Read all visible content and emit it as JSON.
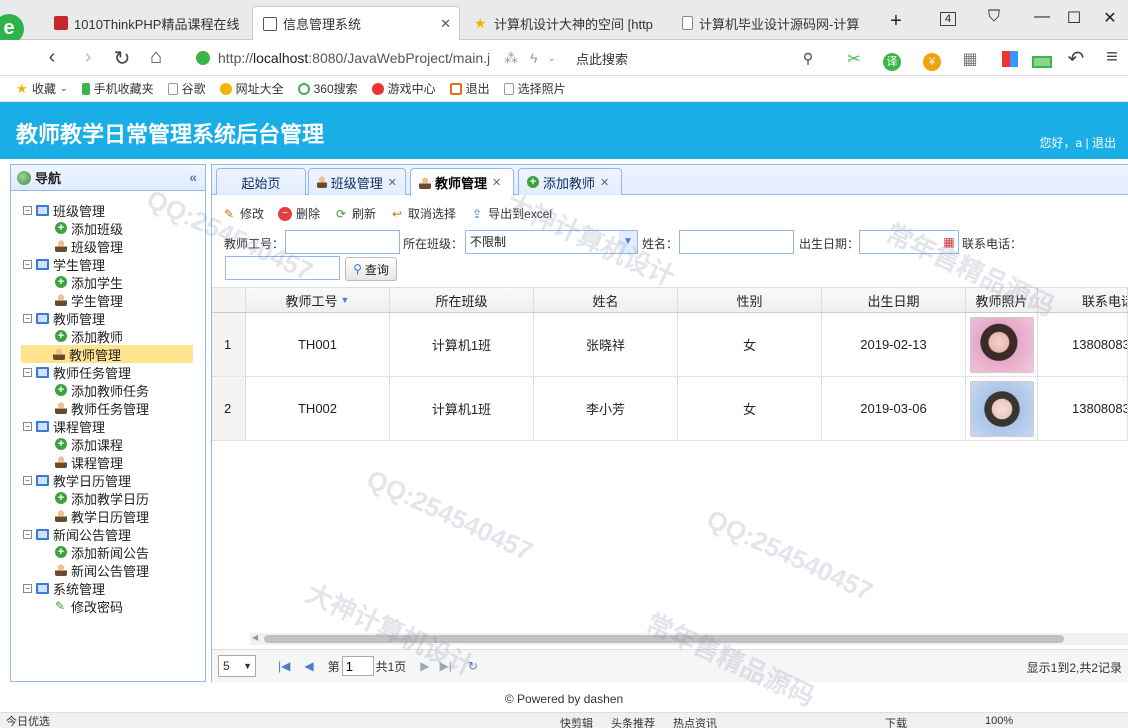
{
  "browser": {
    "tabs": [
      {
        "title": "1010ThinkPHP精品课程在线",
        "active": false
      },
      {
        "title": "信息管理系统",
        "active": true
      },
      {
        "title": "计算机设计大神的空间 [http",
        "active": false
      },
      {
        "title": "计算机毕业设计源码网-计算",
        "active": false
      }
    ],
    "new_tab": "+",
    "tab_count": "4",
    "url_prefix": "http://",
    "url_host": "localhost",
    "url_rest": ":8080/JavaWebProject/main.j",
    "search_placeholder": "点此搜索",
    "bookmarks": [
      "收藏",
      "手机收藏夹",
      "谷歌",
      "网址大全",
      "360搜索",
      "游戏中心",
      "退出",
      "选择照片"
    ]
  },
  "app": {
    "title": "教师教学日常管理系统后台管理",
    "greeting": "您好，a | 退出"
  },
  "nav": {
    "title": "导航",
    "collapse": "«",
    "groups": [
      {
        "label": "班级管理",
        "items": [
          {
            "label": "添加班级",
            "icon": "add"
          },
          {
            "label": "班级管理",
            "icon": "user"
          }
        ]
      },
      {
        "label": "学生管理",
        "items": [
          {
            "label": "添加学生",
            "icon": "add"
          },
          {
            "label": "学生管理",
            "icon": "user"
          }
        ]
      },
      {
        "label": "教师管理",
        "items": [
          {
            "label": "添加教师",
            "icon": "add"
          },
          {
            "label": "教师管理",
            "icon": "user"
          }
        ]
      },
      {
        "label": "教师任务管理",
        "items": [
          {
            "label": "添加教师任务",
            "icon": "add"
          },
          {
            "label": "教师任务管理",
            "icon": "user"
          }
        ]
      },
      {
        "label": "课程管理",
        "items": [
          {
            "label": "添加课程",
            "icon": "add"
          },
          {
            "label": "课程管理",
            "icon": "user"
          }
        ]
      },
      {
        "label": "教学日历管理",
        "items": [
          {
            "label": "添加教学日历",
            "icon": "add"
          },
          {
            "label": "教学日历管理",
            "icon": "user"
          }
        ]
      },
      {
        "label": "新闻公告管理",
        "items": [
          {
            "label": "添加新闻公告",
            "icon": "add"
          },
          {
            "label": "新闻公告管理",
            "icon": "user"
          }
        ]
      },
      {
        "label": "系统管理",
        "items": [
          {
            "label": "修改密码",
            "icon": "pencil"
          }
        ]
      }
    ],
    "selected": "教师管理"
  },
  "content_tabs": [
    {
      "label": "起始页",
      "closable": false
    },
    {
      "label": "班级管理",
      "closable": true
    },
    {
      "label": "教师管理",
      "closable": true,
      "active": true
    },
    {
      "label": "添加教师",
      "closable": true
    }
  ],
  "toolbar": {
    "edit": "修改",
    "delete": "删除",
    "refresh": "刷新",
    "unselect": "取消选择",
    "export": "导出到excel"
  },
  "filters": {
    "teacher_no_label": "教师工号：",
    "class_label": "所在班级：",
    "class_value": "不限制",
    "name_label": "姓名：",
    "birth_label": "出生日期：",
    "phone_label": "联系电话：",
    "query_button": "查询"
  },
  "grid": {
    "columns": [
      "教师工号",
      "所在班级",
      "姓名",
      "性别",
      "出生日期",
      "教师照片",
      "联系电话"
    ],
    "rows": [
      {
        "num": "1",
        "no": "TH001",
        "class": "计算机1班",
        "name": "张晓祥",
        "gender": "女",
        "birth": "2019-02-13",
        "phone": "13808083"
      },
      {
        "num": "2",
        "no": "TH002",
        "class": "计算机1班",
        "name": "李小芳",
        "gender": "女",
        "birth": "2019-03-06",
        "phone": "13808083"
      }
    ]
  },
  "pager": {
    "page_size": "5",
    "page_prefix": "第",
    "page_value": "1",
    "page_suffix": "共1页",
    "info": "显示1到2,共2记录"
  },
  "footer": "© Powered by dashen",
  "status": {
    "left": "今日优选",
    "items": [
      "快剪辑",
      "头条推荐",
      "热点资讯",
      "下载",
      "100%"
    ]
  },
  "watermarks": [
    "QQ:254540457",
    "大神计算机设计",
    "常年售精品源码"
  ]
}
